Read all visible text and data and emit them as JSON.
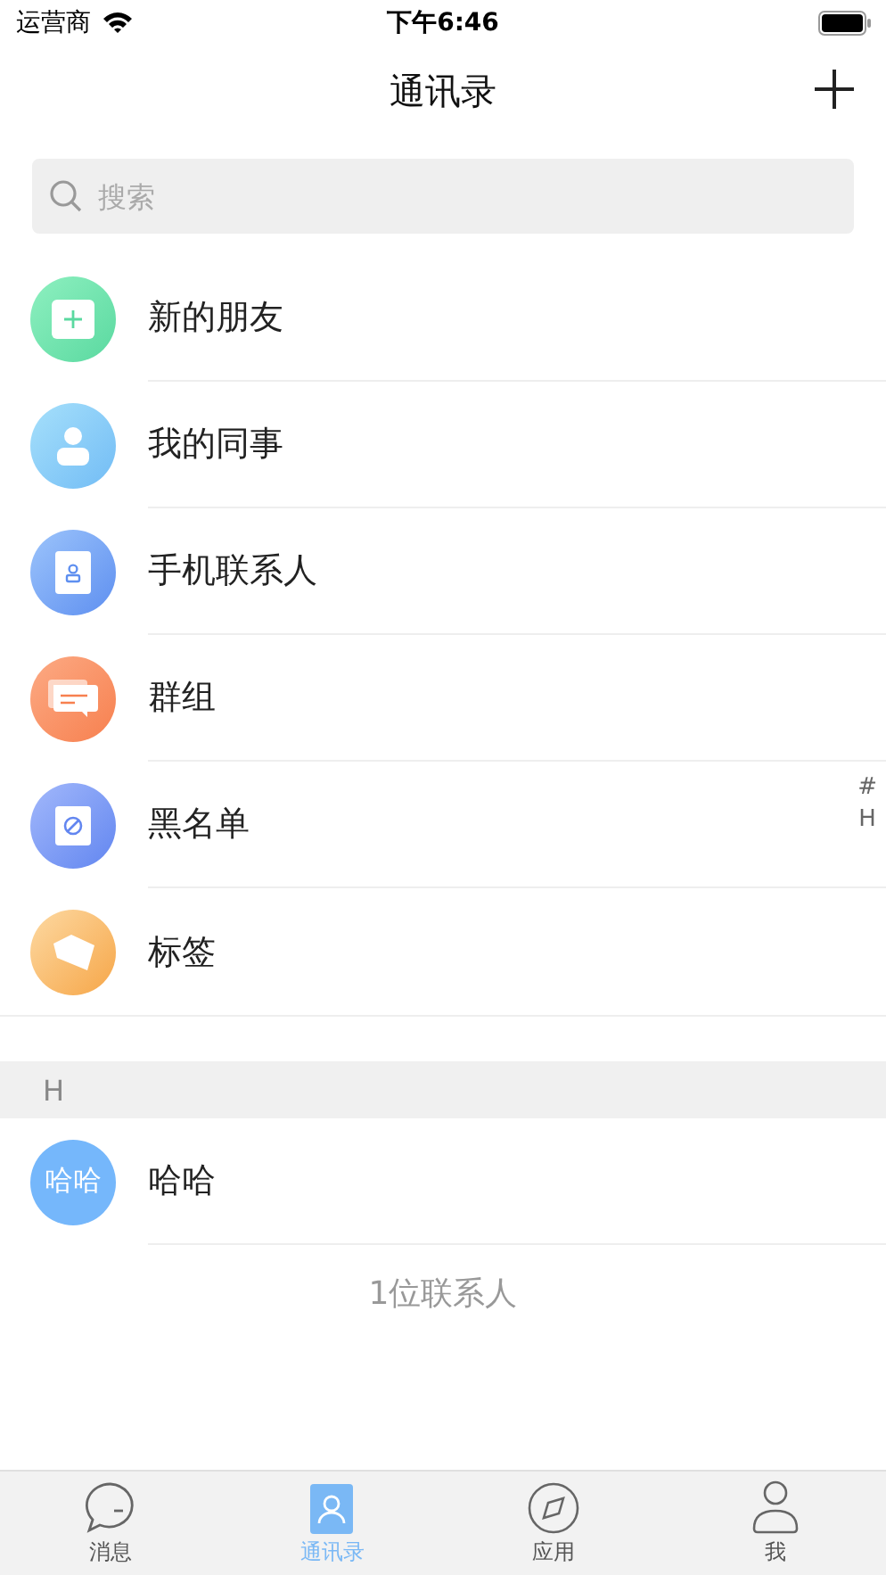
{
  "status_bar": {
    "carrier": "运营商",
    "time": "下午6:46"
  },
  "nav": {
    "title": "通讯录"
  },
  "search": {
    "placeholder": "搜索"
  },
  "entries": [
    {
      "kind": "new-friend",
      "label": "新的朋友"
    },
    {
      "kind": "colleague",
      "label": "我的同事"
    },
    {
      "kind": "phone-contacts",
      "label": "手机联系人"
    },
    {
      "kind": "group",
      "label": "群组"
    },
    {
      "kind": "blacklist",
      "label": "黑名单"
    },
    {
      "kind": "tag",
      "label": "标签"
    }
  ],
  "sections": [
    {
      "letter": "H",
      "contacts": [
        {
          "avatar": "哈哈",
          "name": "哈哈"
        }
      ]
    }
  ],
  "footer": "1位联系人",
  "index": [
    "#",
    "H"
  ],
  "tabs": [
    {
      "kind": "chat",
      "label": "消息",
      "selected": false
    },
    {
      "kind": "contacts",
      "label": "通讯录",
      "selected": true
    },
    {
      "kind": "compass",
      "label": "应用",
      "selected": false
    },
    {
      "kind": "person",
      "label": "我",
      "selected": false
    }
  ]
}
